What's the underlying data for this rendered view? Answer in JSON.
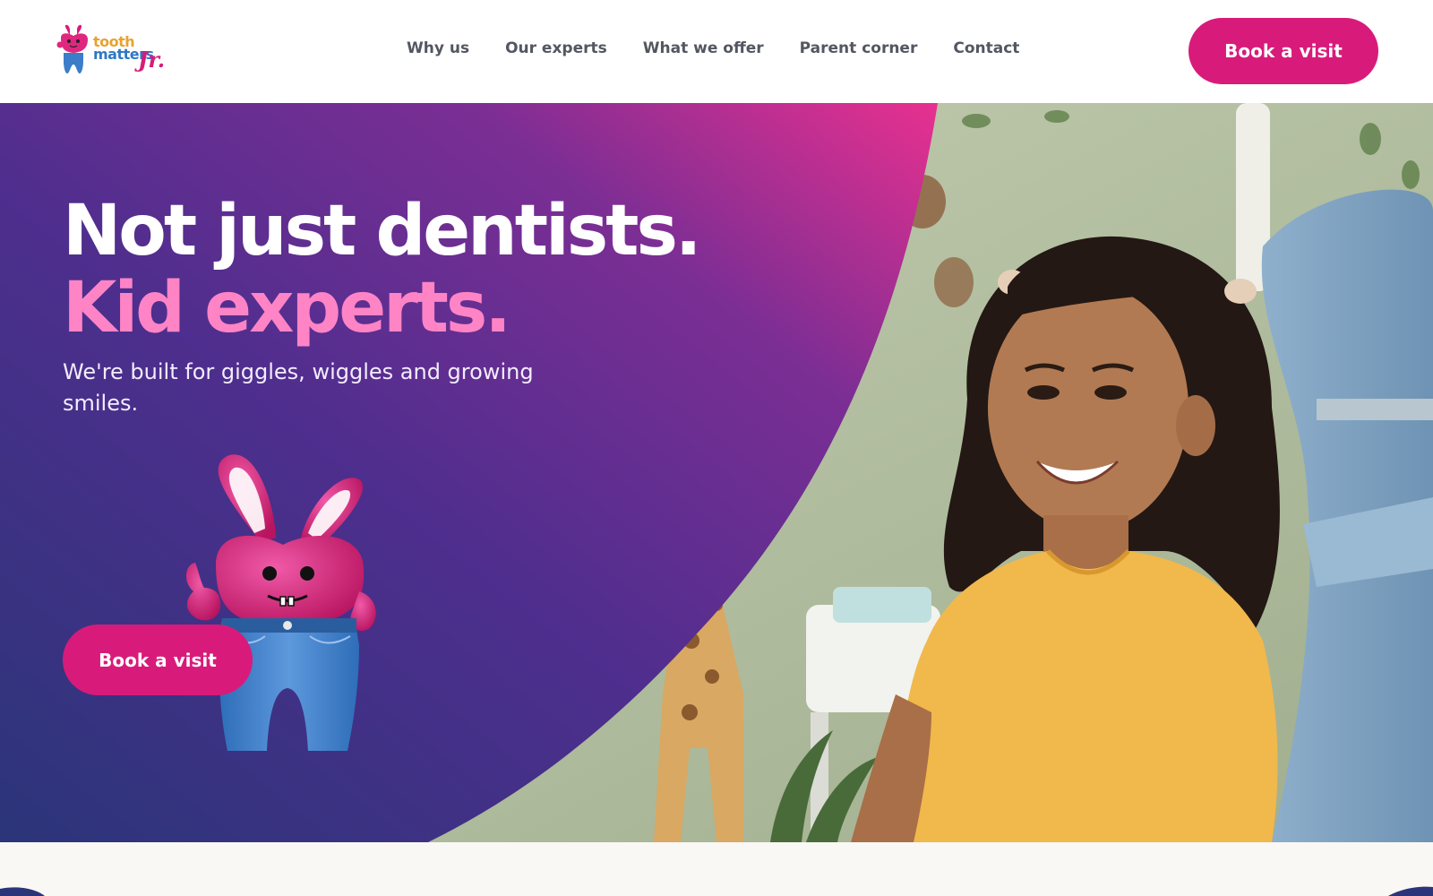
{
  "brand": {
    "logo_line1": "tooth",
    "logo_line2": "matters",
    "logo_suffix": "Jr."
  },
  "nav": {
    "items": [
      "Why us",
      "Our experts",
      "What we offer",
      "Parent corner",
      "Contact"
    ]
  },
  "header": {
    "cta_label": "Book a visit"
  },
  "hero": {
    "headline_1": "Not just dentists.",
    "headline_2": "Kid experts.",
    "subline": "We're built for giggles, wiggles and growing smiles.",
    "cta_label": "Book a visit"
  },
  "colors": {
    "accent": "#d81b7a",
    "headline_pink": "#ff84c6",
    "panel_top": "#7a2e90",
    "panel_bottom": "#2f3a7e"
  },
  "icons": {
    "logo": "bunny-tooth-logo",
    "mascot": "bunny-tooth-mascot"
  }
}
